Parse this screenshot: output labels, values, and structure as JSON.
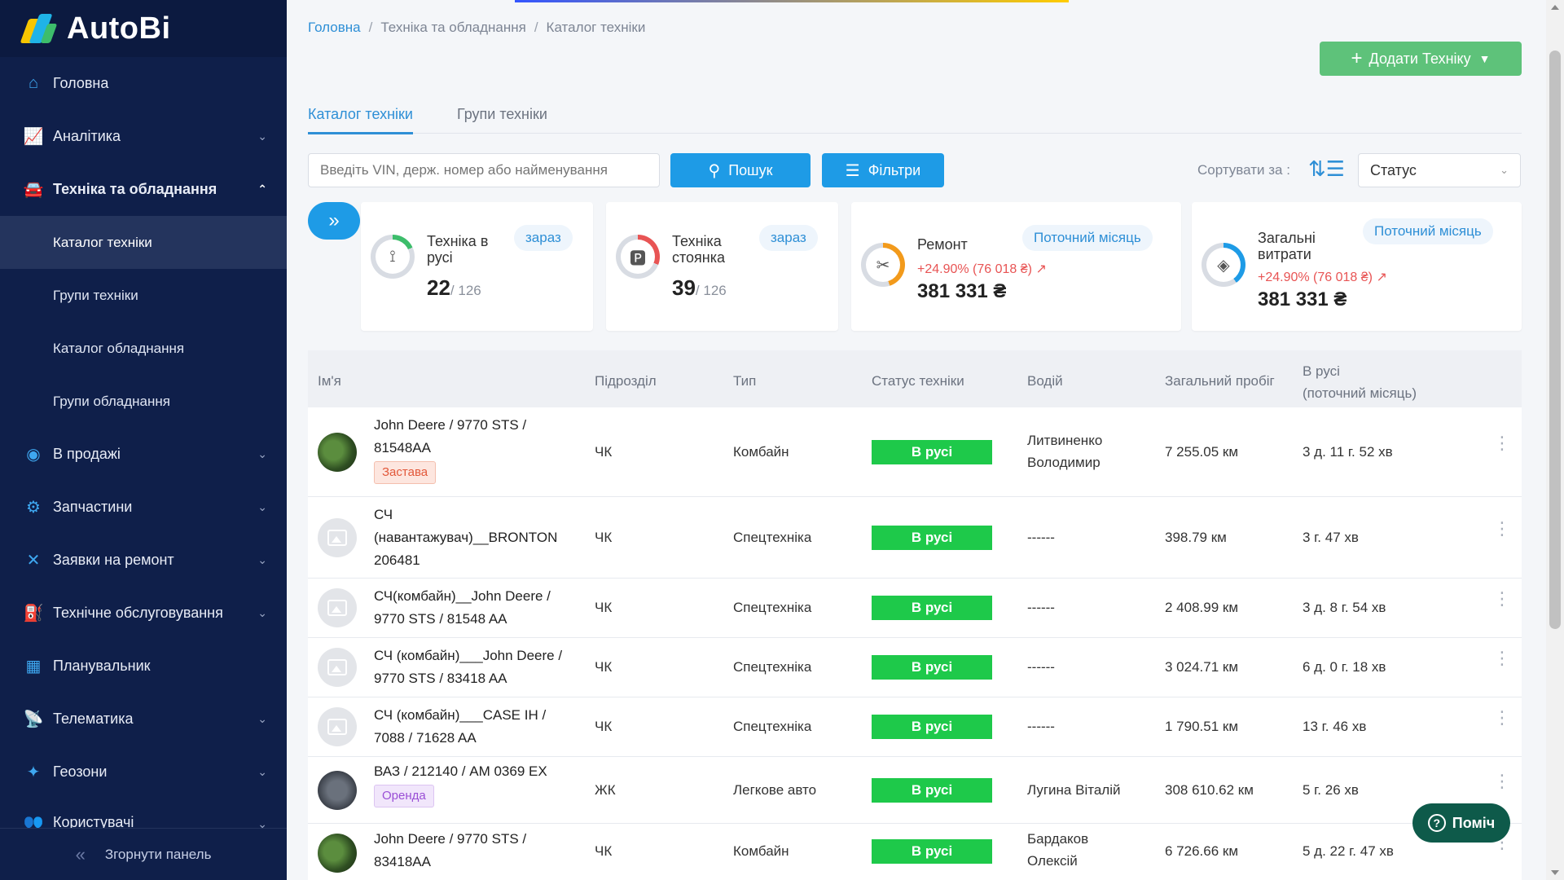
{
  "app": {
    "logo_prefix": "Auto",
    "logo_suffix": "Bi"
  },
  "sidebar": {
    "items": [
      {
        "label": "Головна",
        "icon": "home-icon"
      },
      {
        "label": "Аналітика",
        "icon": "chart-icon"
      },
      {
        "label": "Техніка та обладнання",
        "icon": "car-icon"
      },
      {
        "label": "В продажі",
        "icon": "sale-icon"
      },
      {
        "label": "Запчастини",
        "icon": "parts-icon"
      },
      {
        "label": "Заявки на ремонт",
        "icon": "wrench-icon"
      },
      {
        "label": "Технічне обслуговування",
        "icon": "service-icon"
      },
      {
        "label": "Планувальник",
        "icon": "calendar-icon"
      },
      {
        "label": "Телематика",
        "icon": "satellite-icon"
      },
      {
        "label": "Геозони",
        "icon": "geo-icon"
      },
      {
        "label": "Користувачі",
        "icon": "users-icon"
      }
    ],
    "subitems": [
      "Каталог техніки",
      "Групи техніки",
      "Каталог обладнання",
      "Групи обладнання"
    ],
    "collapse_label": "Згорнути панель"
  },
  "breadcrumb": [
    "Головна",
    "Техніка та обладнання",
    "Каталог техніки"
  ],
  "add_button": "Додати Техніку",
  "tabs": [
    "Каталог техніки",
    "Групи техніки"
  ],
  "search": {
    "placeholder": "Введіть VIN, держ. номер або найменування",
    "button": "Пошук",
    "filters": "Фільтри"
  },
  "sort": {
    "label": "Сортувати за :",
    "value": "Статус"
  },
  "cards": [
    {
      "title1": "Техніка в",
      "title2": "русі",
      "pill": "зараз",
      "value": "22",
      "of": "/ 126",
      "color": "#3dbd6b"
    },
    {
      "title1": "Техніка",
      "title2": "стоянка",
      "pill": "зараз",
      "value": "39",
      "of": "/ 126",
      "color": "#e85454"
    },
    {
      "title": "Ремонт",
      "pill": "Поточний місяць",
      "delta": "+24.90% (76 018 ₴) ↗",
      "value": "381 331 ₴",
      "color": "#f29a1b"
    },
    {
      "title1": "Загальні",
      "title2": "витрати",
      "pill": "Поточний місяць",
      "delta": "+24.90% (76 018 ₴) ↗",
      "value": "381 331 ₴",
      "color": "#1e9be6"
    }
  ],
  "table": {
    "headers": [
      "Ім'я",
      "Підрозділ",
      "Тип",
      "Статус техніки",
      "Водій",
      "Загальний пробіг",
      "В русі",
      "(поточний місяць)"
    ],
    "rows": [
      {
        "name1": "John Deere / 9770 STS /",
        "name2": "81548AA",
        "tag": "Застава",
        "unit": "ЧК",
        "type": "Комбайн",
        "status": "В русі",
        "driver1": "Литвиненко",
        "driver2": "Володимир",
        "mileage": "7 255.05 км",
        "moving": "3 д. 11 г. 52 хв"
      },
      {
        "name1": "СЧ",
        "name2": "(навантажувач)__BRONTON",
        "name3": "206481",
        "unit": "ЧК",
        "type": "Спецтехніка",
        "status": "В русі",
        "driver1": "------",
        "mileage": "398.79 км",
        "moving": "3 г. 47 хв"
      },
      {
        "name1": "СЧ(комбайн)__John Deere /",
        "name2": "9770 STS / 81548 AA",
        "unit": "ЧК",
        "type": "Спецтехніка",
        "status": "В русі",
        "driver1": "------",
        "mileage": "2 408.99 км",
        "moving": "3 д. 8 г. 54 хв"
      },
      {
        "name1": "СЧ (комбайн)___John Deere /",
        "name2": "9770 STS / 83418 AA",
        "unit": "ЧК",
        "type": "Спецтехніка",
        "status": "В русі",
        "driver1": "------",
        "mileage": "3 024.71 км",
        "moving": "6 д. 0 г. 18 хв"
      },
      {
        "name1": "СЧ (комбайн)___CASE IH /",
        "name2": "7088 / 71628 AA",
        "unit": "ЧК",
        "type": "Спецтехніка",
        "status": "В русі",
        "driver1": "------",
        "mileage": "1 790.51 км",
        "moving": "13 г. 46 хв"
      },
      {
        "name1": "ВАЗ / 212140 / АМ 0369 ЕХ",
        "tag": "Оренда",
        "unit": "ЖК",
        "type": "Легкове авто",
        "status": "В русі",
        "driver1": "Лугина Віталій",
        "mileage": "308 610.62 км",
        "moving": "5 г. 26 хв"
      },
      {
        "name1": "John Deere / 9770 STS /",
        "name2": "83418AA",
        "unit": "ЧК",
        "type": "Комбайн",
        "status": "В русі",
        "driver1": "Бардаков",
        "driver2": "Олексій",
        "mileage": "6 726.66 км",
        "moving": "5 д. 22 г. 47 хв"
      }
    ]
  },
  "help": "Поміч"
}
